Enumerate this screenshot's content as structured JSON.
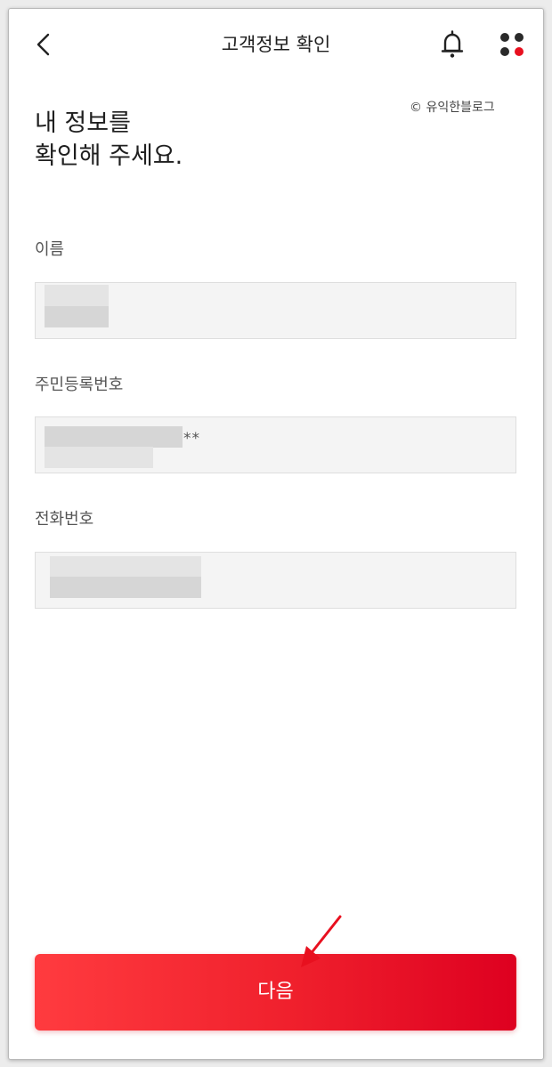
{
  "header": {
    "title": "고객정보 확인"
  },
  "watermark": "© 유익한블로그",
  "headline": {
    "line1": "내 정보를",
    "line2": "확인해 주세요."
  },
  "fields": {
    "name": {
      "label": "이름"
    },
    "rrn": {
      "label": "주민등록번호",
      "masked_suffix": "**"
    },
    "phone": {
      "label": "전화번호"
    }
  },
  "next_button": {
    "label": "다음"
  },
  "colors": {
    "accent": "#e8101f",
    "annotation_arrow": "#e8101f"
  },
  "icons": [
    "back-arrow-icon",
    "bell-icon",
    "apps-dots-icon"
  ]
}
